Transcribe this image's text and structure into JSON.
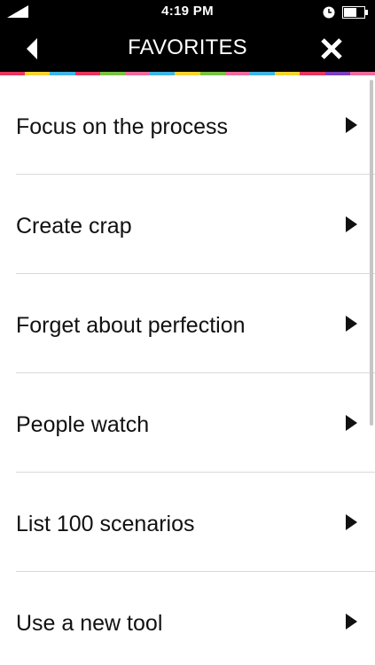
{
  "status_bar": {
    "time": "4:19 PM",
    "icons": [
      "signal-icon",
      "clock-icon",
      "battery-icon"
    ]
  },
  "nav": {
    "title": "FAVORITES",
    "back_icon": "back-arrow-icon",
    "close_icon": "close-icon"
  },
  "color_strip": [
    "#e8365d",
    "#f6d330",
    "#3fb4e5",
    "#e8365d",
    "#7ac143",
    "#ee6c9c",
    "#3fb4e5",
    "#f6d330",
    "#7ac143",
    "#ee6c9c",
    "#3fb4e5",
    "#f6d330",
    "#e8365d",
    "#7b3fbf",
    "#ee6c9c"
  ],
  "items": [
    {
      "label": "Focus on the process"
    },
    {
      "label": "Create crap"
    },
    {
      "label": "Forget about perfection"
    },
    {
      "label": "People watch"
    },
    {
      "label": "List 100 scenarios"
    },
    {
      "label": "Use a new tool"
    }
  ],
  "colors": {
    "bar": "#000000",
    "text": "#111111",
    "divider": "#d9d9d9"
  }
}
